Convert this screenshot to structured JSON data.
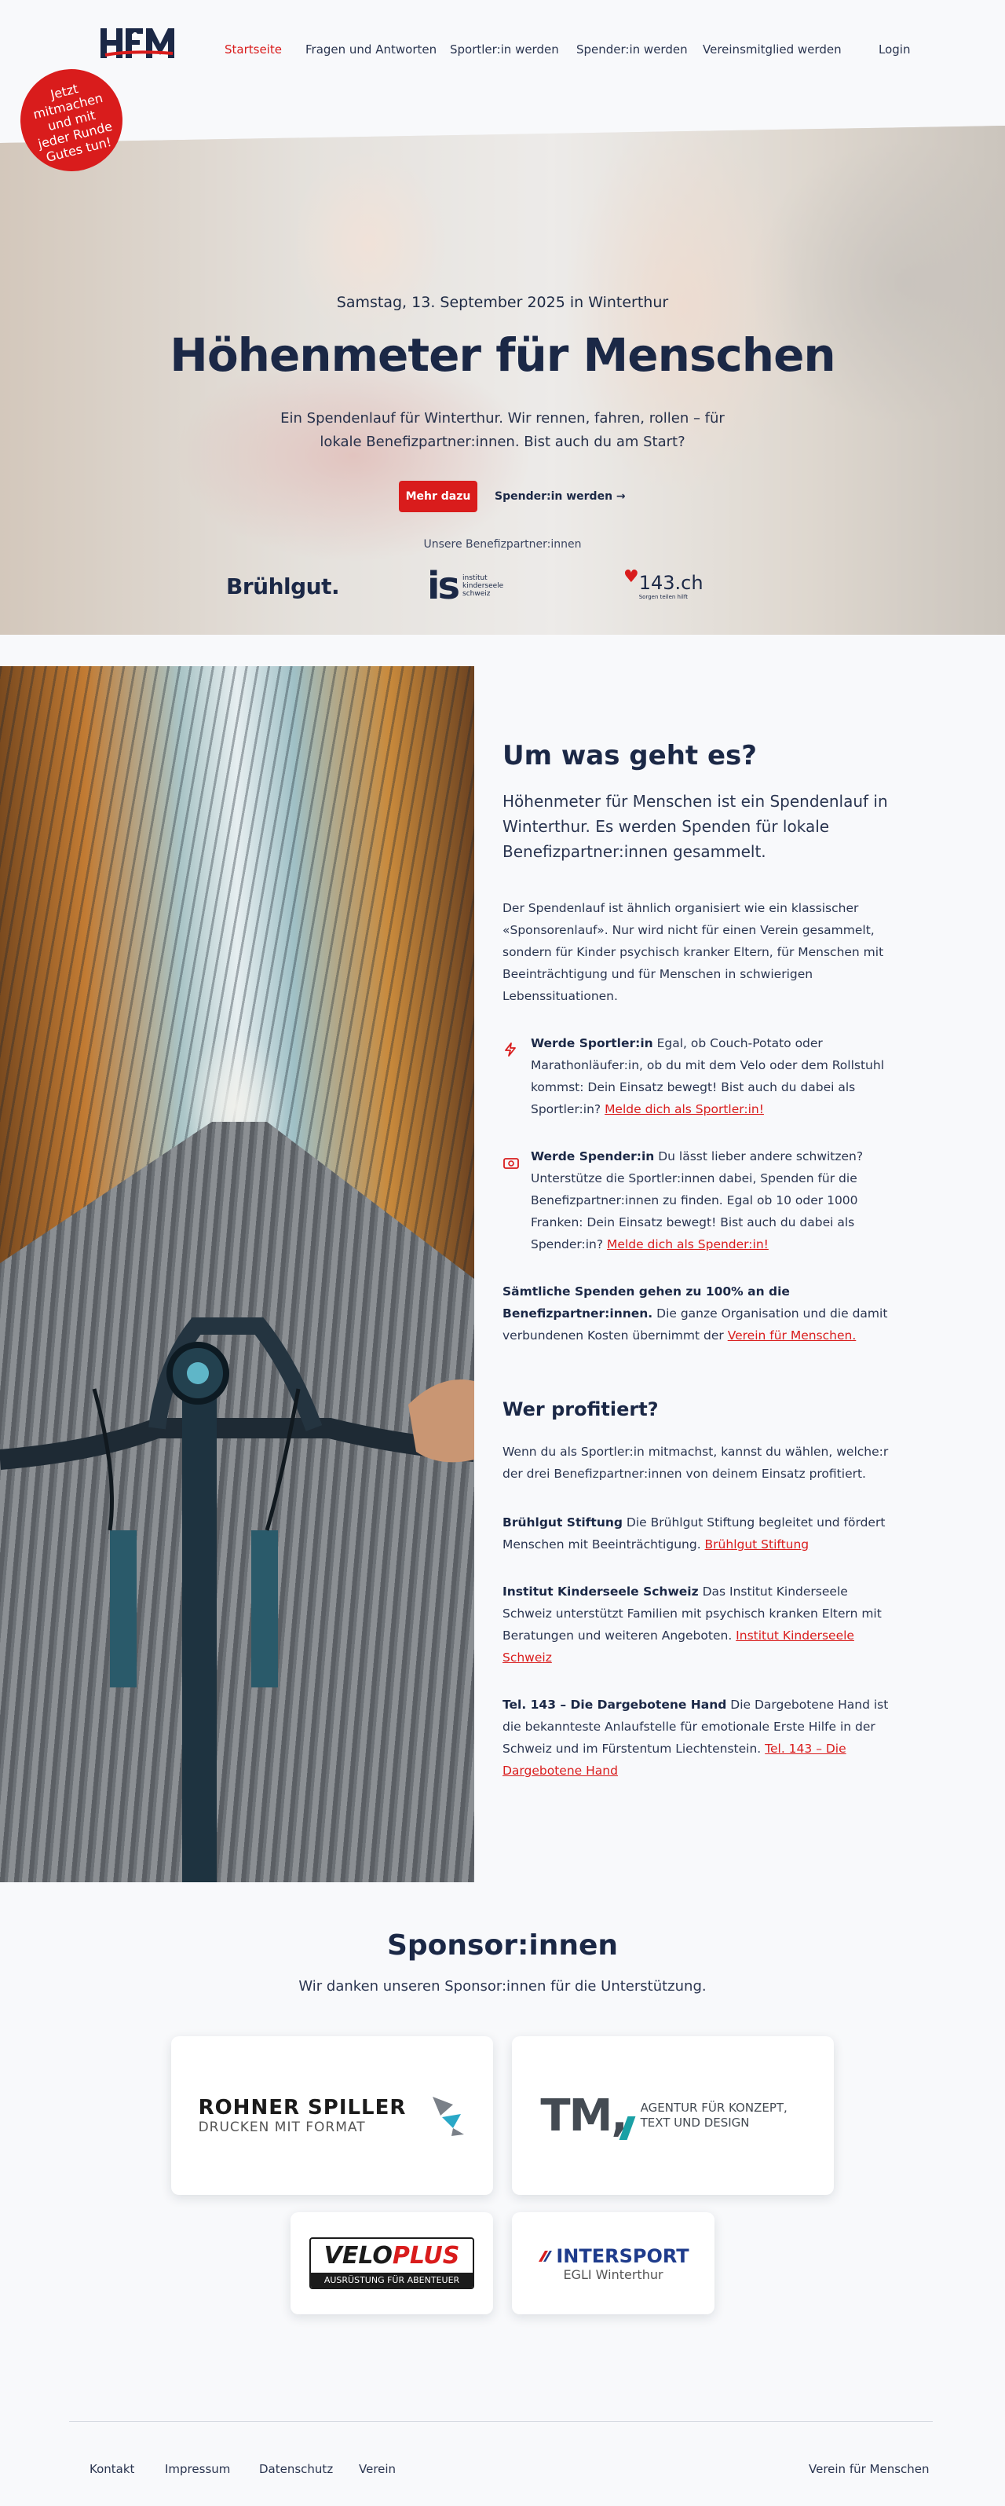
{
  "header": {
    "logo_alt": "HFM",
    "nav": [
      {
        "label": "Startseite"
      },
      {
        "label": "Fragen und Antworten"
      },
      {
        "label": "Sportler:in werden"
      },
      {
        "label": "Spender:in werden"
      },
      {
        "label": "Vereinsmitglied werden"
      }
    ],
    "login": "Login"
  },
  "hero": {
    "badge": "Jetzt mitmachen und mit jeder Runde Gutes tun!",
    "date": "Samstag, 13. September 2025 in Winterthur",
    "title": "Höhenmeter für Menschen",
    "lead": "Ein Spendenlauf für Winterthur. Wir rennen, fahren, rollen – für lokale Benefizpartner:innen. Bist auch du am Start?",
    "cta_primary": "Mehr dazu",
    "cta_secondary": "Spender:in werden →",
    "partners_label": "Unsere Benefizpartner:innen",
    "partners": [
      {
        "name": "Brühlgut."
      },
      {
        "name": "is",
        "sub": "institut kinderseele schweiz"
      },
      {
        "name": "143.ch",
        "sub": "Sorgen teilen hilft"
      }
    ]
  },
  "about": {
    "title": "Um was geht es?",
    "lead": "Höhenmeter für Menschen ist ein Spendenlauf in Winterthur. Es werden Spenden für lokale Benefizpartner:innen gesammelt.",
    "body": "Der Spendenlauf ist ähnlich organisiert wie ein klassischer «Sponsorenlauf». Nur wird nicht für einen Verein gesammelt, sondern für Kinder psychisch kranker Eltern, für Menschen mit Beeinträchtigung und für Menschen in schwierigen Lebenssituationen.",
    "athlete": {
      "heading": "Werde Sportler:in",
      "text": " Egal, ob Couch-Potato oder Marathonläufer:in, ob du mit dem Velo oder dem Rollstuhl kommst: Dein Einsatz bewegt! Bist auch du dabei als Sportler:in? ",
      "link": "Melde dich als Sportler:in!"
    },
    "donor": {
      "heading": "Werde Spender:in",
      "text": " Du lässt lieber andere schwitzen? Unterstütze die Sportler:innen dabei, Spenden für die Benefizpartner:innen zu finden. Egal ob 10 oder 1000 Franken: Dein Einsatz bewegt! Bist auch du dabei als Spender:in? ",
      "link": "Melde dich als Spender:in!"
    },
    "all_donations": {
      "heading": "Sämtliche Spenden gehen zu 100% an die Benefizpartner:innen.",
      "text": " Die ganze Organisation und die damit verbundenen Kosten übernimmt der ",
      "link": "Verein für Menschen."
    }
  },
  "beneficiaries": {
    "title": "Wer profitiert?",
    "intro": "Wenn du als Sportler:in mitmachst, kannst du wählen, welche:r der drei Benefizpartner:innen von deinem Einsatz profitiert.",
    "items": [
      {
        "heading": "Brühlgut Stiftung",
        "text": " Die Brühlgut Stiftung begleitet und fördert Menschen mit Beeinträchtigung. ",
        "link": "Brühlgut Stiftung"
      },
      {
        "heading": "Institut Kinderseele Schweiz",
        "text": " Das Institut Kinderseele Schweiz unterstützt Familien mit psychisch kranken Eltern mit Beratungen und weiteren Angeboten. ",
        "link": "Institut Kinderseele Schweiz"
      },
      {
        "heading": "Tel. 143 – Die Dargebotene Hand",
        "text": " Die Dargebotene Hand ist die bekannteste Anlaufstelle für emotionale Erste Hilfe in der Schweiz und im Fürstentum Liechtenstein. ",
        "link": "Tel. 143 – Die Dargebotene Hand"
      }
    ]
  },
  "sponsors": {
    "title": "Sponsor:innen",
    "subtitle": "Wir danken unseren Sponsor:innen für die Unterstützung.",
    "items": [
      {
        "name": "ROHNER SPILLER",
        "tagline": "DRUCKEN MIT FORMAT"
      },
      {
        "name": "TM,",
        "tagline": "AGENTUR FÜR KONZEPT, TEXT UND DESIGN"
      },
      {
        "name": "VELO",
        "name2": "PLUS",
        "tagline": "AUSRÜSTUNG FÜR ABENTEUER"
      },
      {
        "name": "INTERSPORT",
        "tagline": "EGLI Winterthur"
      }
    ]
  },
  "footer": {
    "links": [
      "Kontakt",
      "Impressum",
      "Datenschutz",
      "Verein"
    ],
    "right": "Verein für Menschen"
  },
  "colors": {
    "accent": "#d91c1c",
    "navy": "#1b2846",
    "bg": "#f8f9fb"
  }
}
